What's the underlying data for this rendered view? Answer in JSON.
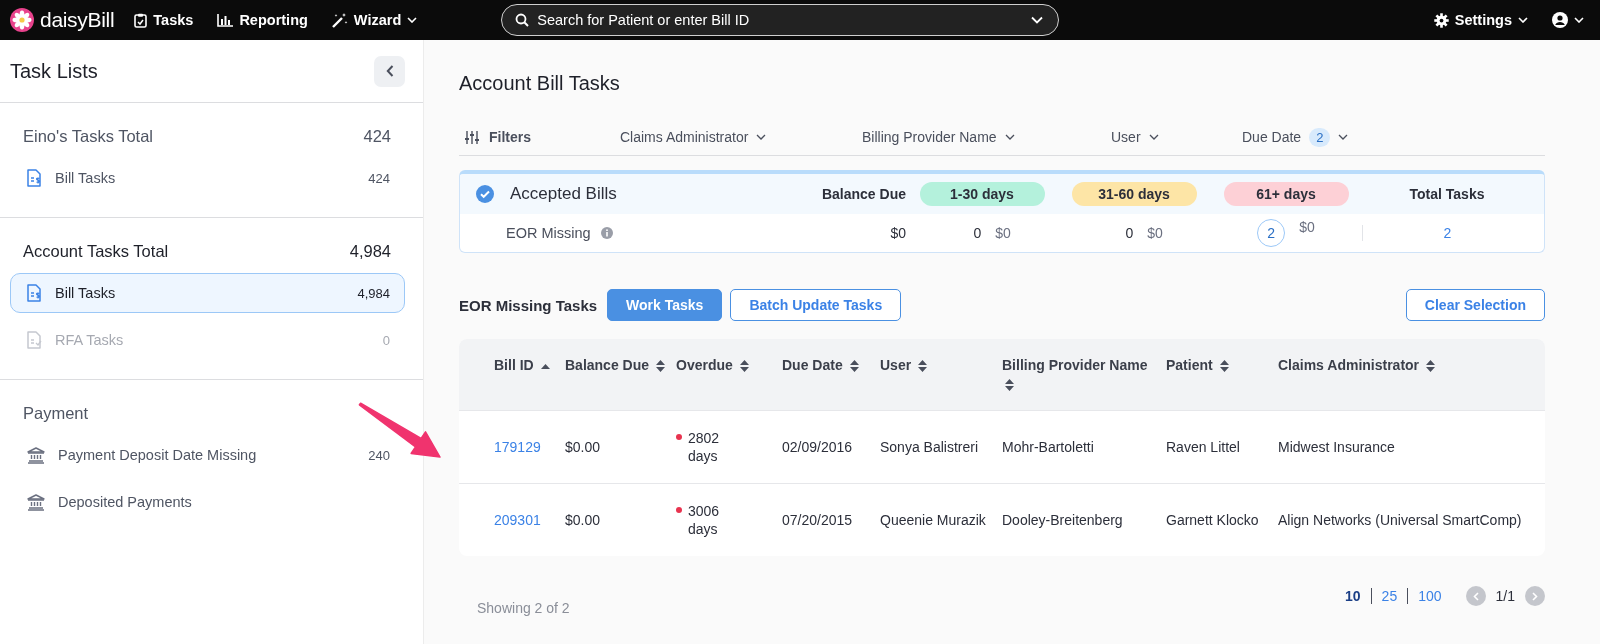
{
  "nav": {
    "brand": "daisyBill",
    "items": [
      {
        "label": "Tasks",
        "kind": "clipboard",
        "dropdown": false
      },
      {
        "label": "Reporting",
        "kind": "chart",
        "dropdown": false
      },
      {
        "label": "Wizard",
        "kind": "wand",
        "dropdown": true
      }
    ],
    "search": {
      "placeholder": "Search for Patient or enter Bill ID"
    },
    "settings": "Settings"
  },
  "sidebar": {
    "title": "Task Lists",
    "groups": [
      {
        "title": "Eino's Tasks Total",
        "total": "424",
        "strong": false,
        "items": [
          {
            "label": "Bill Tasks",
            "count": "424",
            "kind": "bill",
            "selected": false,
            "disabled": false
          }
        ]
      },
      {
        "title": "Account Tasks Total",
        "total": "4,984",
        "strong": true,
        "items": [
          {
            "label": "Bill Tasks",
            "count": "4,984",
            "kind": "bill",
            "selected": true,
            "disabled": false
          },
          {
            "label": "RFA Tasks",
            "count": "0",
            "kind": "rfa",
            "selected": false,
            "disabled": true
          }
        ]
      },
      {
        "title": "Payment",
        "strong": false,
        "items": [
          {
            "label": "Payment Deposit Date Missing",
            "count": "240",
            "kind": "bank",
            "selected": false,
            "disabled": false
          },
          {
            "label": "Deposited Payments",
            "kind": "bank",
            "selected": false,
            "disabled": false
          }
        ]
      }
    ]
  },
  "page": {
    "title": "Account Bill Tasks",
    "filters": {
      "label": "Filters",
      "items": [
        {
          "label": "Claims Administrator"
        },
        {
          "label": "Billing Provider Name"
        },
        {
          "label": "User"
        },
        {
          "label": "Due Date",
          "badge": "2"
        }
      ]
    }
  },
  "summary": {
    "title": "Accepted Bills",
    "balance_label": "Balance Due",
    "buckets": [
      {
        "label": "1-30 days",
        "color": "#b4f1dc"
      },
      {
        "label": "31-60 days",
        "color": "#fde5a6"
      },
      {
        "label": "61+ days",
        "color": "#fdd0d6"
      }
    ],
    "total_label": "Total Tasks",
    "rows": [
      {
        "label": "EOR Missing",
        "balance": "$0",
        "buckets": [
          {
            "count": "0",
            "amount": "$0"
          },
          {
            "count": "0",
            "amount": "$0"
          },
          {
            "count": "2",
            "amount": "$0"
          }
        ],
        "total": "2"
      }
    ]
  },
  "tasks": {
    "title": "EOR Missing Tasks",
    "buttons": [
      {
        "label": "Work Tasks",
        "kind": "primary"
      },
      {
        "label": "Batch Update Tasks",
        "kind": "outline"
      }
    ],
    "clear": "Clear Selection",
    "columns": [
      {
        "label": "Bill ID",
        "sorted": true
      },
      {
        "label": "Balance Due",
        "sorted": false
      },
      {
        "label": "Overdue",
        "sorted": false
      },
      {
        "label": "Due Date",
        "sorted": false
      },
      {
        "label": "User",
        "sorted": false
      },
      {
        "label": "Billing Provider Name",
        "sorted": false
      },
      {
        "label": "Patient",
        "sorted": false
      },
      {
        "label": "Claims Administrator",
        "sorted": false
      }
    ],
    "rows": [
      {
        "bill_id": "179129",
        "balance": "$0.00",
        "overdue": "2802 days",
        "due_date": "02/09/2016",
        "user": "Sonya Balistreri",
        "provider": "Mohr-Bartoletti",
        "patient": "Raven Littel",
        "claims_admin": "Midwest Insurance"
      },
      {
        "bill_id": "209301",
        "balance": "$0.00",
        "overdue": "3006 days",
        "due_date": "07/20/2015",
        "user": "Queenie Murazik",
        "provider": "Dooley-Breitenberg",
        "patient": "Garnett Klocko",
        "claims_admin": "Align Networks (Universal SmartComp)"
      }
    ],
    "showing": "Showing 2 of 2",
    "page_sizes": [
      {
        "label": "10",
        "selected": true
      },
      {
        "label": "25",
        "selected": false
      },
      {
        "label": "100",
        "selected": false
      }
    ],
    "page": "1/1"
  },
  "annotation": {
    "kind": "arrow"
  }
}
